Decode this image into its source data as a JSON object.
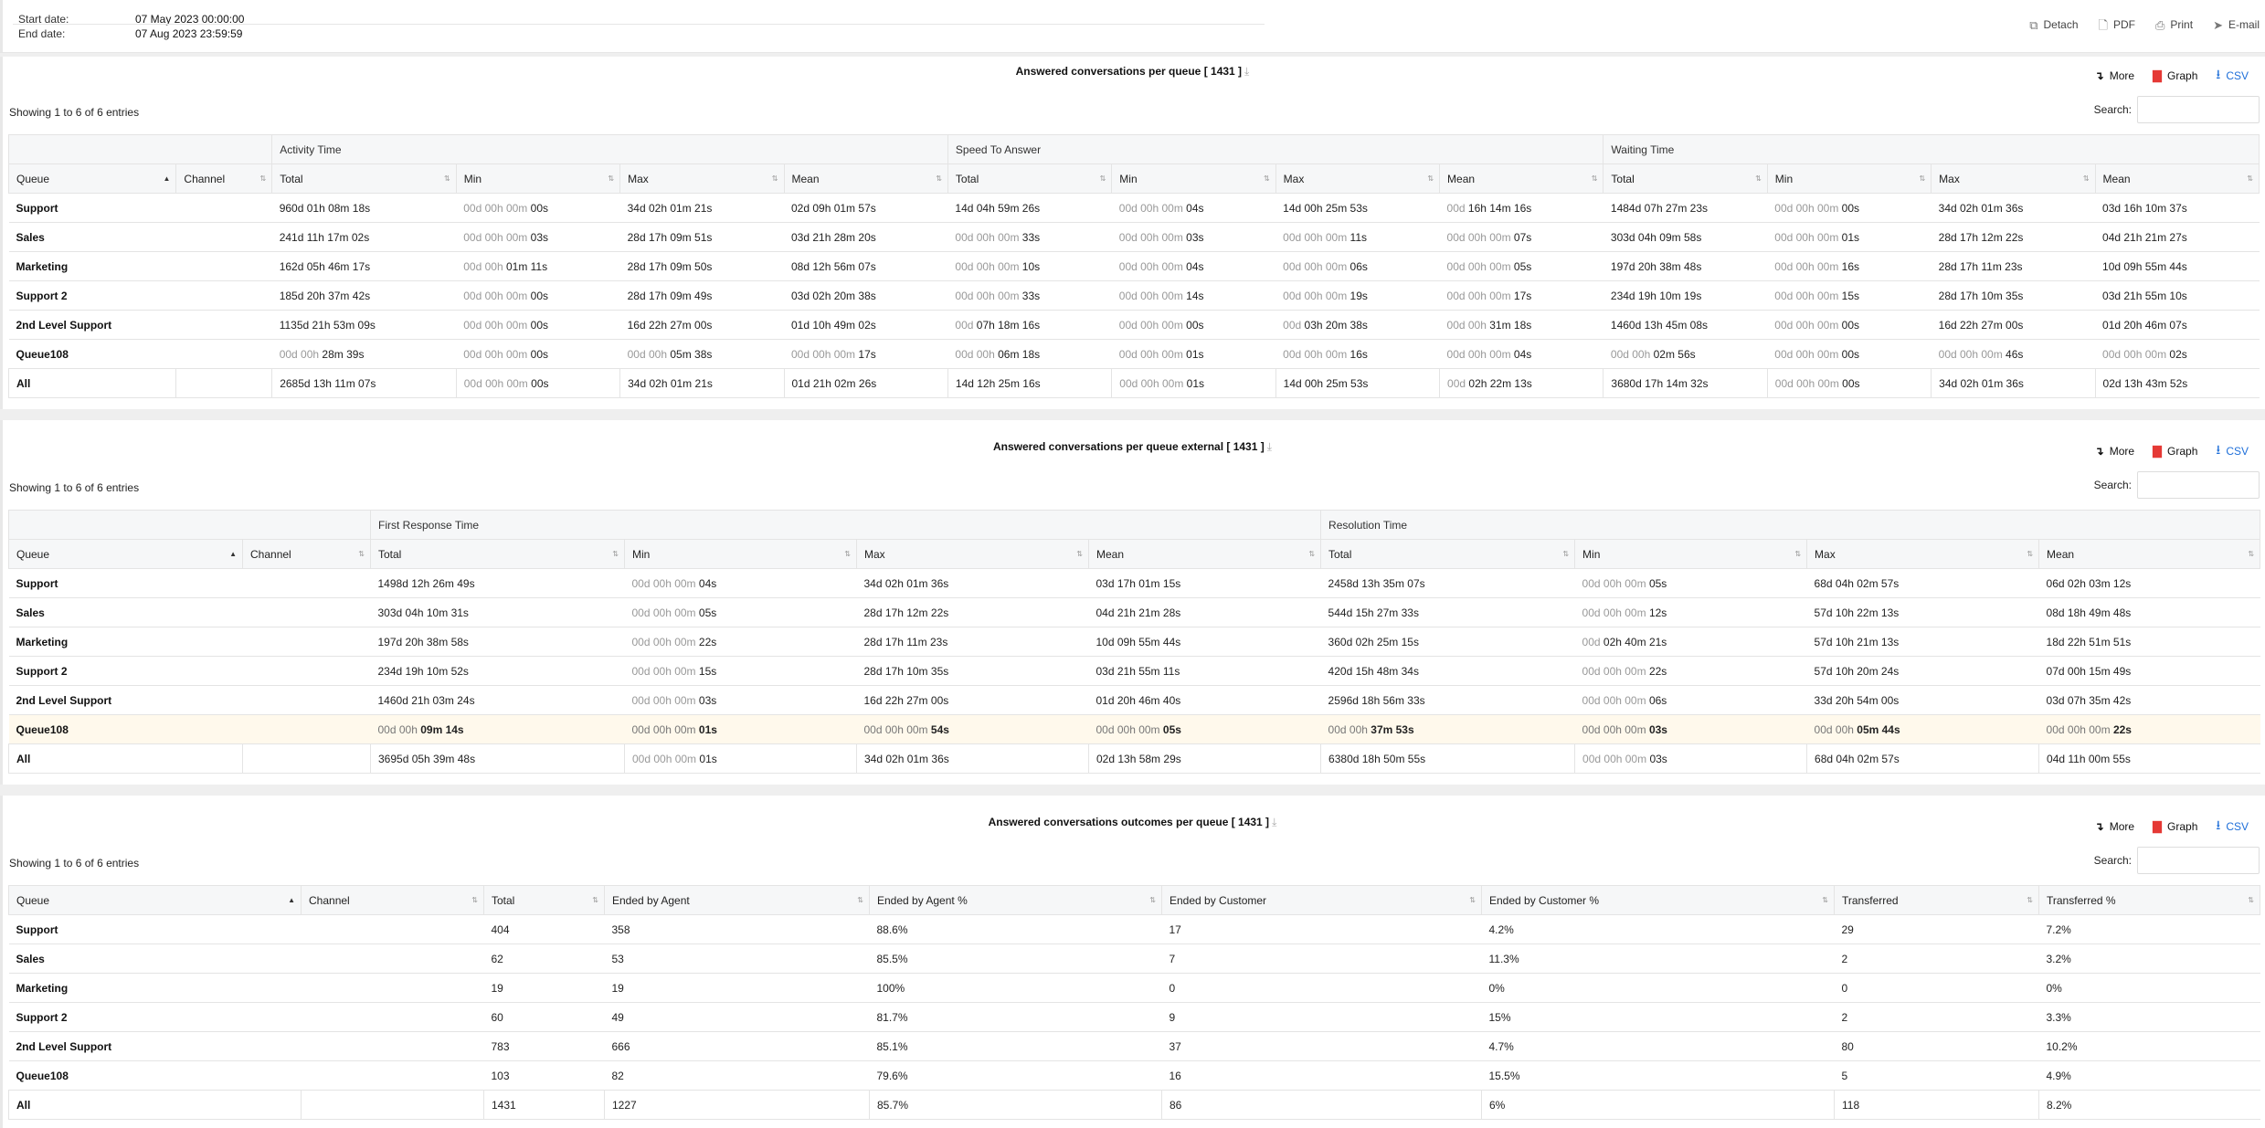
{
  "header": {
    "start_label": "Start date:",
    "start_value": "07 May 2023 00:00:00",
    "end_label": "End date:",
    "end_value": "07 Aug 2023 23:59:59",
    "actions": [
      "Detach",
      "PDF",
      "Print",
      "E-mail"
    ]
  },
  "common": {
    "more": "More",
    "graph": "Graph",
    "csv": "CSV",
    "search_label": "Search:",
    "showing": "Showing 1 to 6 of 6 entries"
  },
  "t1": {
    "title": "Answered conversations per queue [ 1431 ]",
    "groups": [
      "Activity Time",
      "Speed To Answer",
      "Waiting Time"
    ],
    "columns": [
      "Queue",
      "Channel",
      "Total",
      "Min",
      "Max",
      "Mean",
      "Total",
      "Min",
      "Max",
      "Mean",
      "Total",
      "Min",
      "Max",
      "Mean"
    ],
    "rows": [
      [
        "Support",
        "",
        "960d 01h 08m 18s",
        "00d 00h 00m 00s",
        "34d 02h 01m 21s",
        "02d 09h 01m 57s",
        "14d 04h 59m 26s",
        "00d 00h 00m 04s",
        "14d 00h 25m 53s",
        "00d 16h 14m 16s",
        "1484d 07h 27m 23s",
        "00d 00h 00m 00s",
        "34d 02h 01m 36s",
        "03d 16h 10m 37s"
      ],
      [
        "Sales",
        "",
        "241d 11h 17m 02s",
        "00d 00h 00m 03s",
        "28d 17h 09m 51s",
        "03d 21h 28m 20s",
        "00d 00h 00m 33s",
        "00d 00h 00m 03s",
        "00d 00h 00m 11s",
        "00d 00h 00m 07s",
        "303d 04h 09m 58s",
        "00d 00h 00m 01s",
        "28d 17h 12m 22s",
        "04d 21h 21m 27s"
      ],
      [
        "Marketing",
        "",
        "162d 05h 46m 17s",
        "00d 00h 01m 11s",
        "28d 17h 09m 50s",
        "08d 12h 56m 07s",
        "00d 00h 00m 10s",
        "00d 00h 00m 04s",
        "00d 00h 00m 06s",
        "00d 00h 00m 05s",
        "197d 20h 38m 48s",
        "00d 00h 00m 16s",
        "28d 17h 11m 23s",
        "10d 09h 55m 44s"
      ],
      [
        "Support 2",
        "",
        "185d 20h 37m 42s",
        "00d 00h 00m 00s",
        "28d 17h 09m 49s",
        "03d 02h 20m 38s",
        "00d 00h 00m 33s",
        "00d 00h 00m 14s",
        "00d 00h 00m 19s",
        "00d 00h 00m 17s",
        "234d 19h 10m 19s",
        "00d 00h 00m 15s",
        "28d 17h 10m 35s",
        "03d 21h 55m 10s"
      ],
      [
        "2nd Level Support",
        "",
        "1135d 21h 53m 09s",
        "00d 00h 00m 00s",
        "16d 22h 27m 00s",
        "01d 10h 49m 02s",
        "00d 07h 18m 16s",
        "00d 00h 00m 00s",
        "00d 03h 20m 38s",
        "00d 00h 31m 18s",
        "1460d 13h 45m 08s",
        "00d 00h 00m 00s",
        "16d 22h 27m 00s",
        "01d 20h 46m 07s"
      ],
      [
        "Queue108",
        "",
        "00d 00h 28m 39s",
        "00d 00h 00m 00s",
        "00d 00h 05m 38s",
        "00d 00h 00m 17s",
        "00d 00h 06m 18s",
        "00d 00h 00m 01s",
        "00d 00h 00m 16s",
        "00d 00h 00m 04s",
        "00d 00h 02m 56s",
        "00d 00h 00m 00s",
        "00d 00h 00m 46s",
        "00d 00h 00m 02s"
      ]
    ],
    "total": [
      "All",
      "",
      "2685d 13h 11m 07s",
      "00d 00h 00m 00s",
      "34d 02h 01m 21s",
      "01d 21h 02m 26s",
      "14d 12h 25m 16s",
      "00d 00h 00m 01s",
      "14d 00h 25m 53s",
      "00d 02h 22m 13s",
      "3680d 17h 14m 32s",
      "00d 00h 00m 00s",
      "34d 02h 01m 36s",
      "02d 13h 43m 52s"
    ]
  },
  "t2": {
    "title": "Answered conversations per queue external [ 1431 ]",
    "groups": [
      "First Response Time",
      "Resolution Time"
    ],
    "columns": [
      "Queue",
      "Channel",
      "Total",
      "Min",
      "Max",
      "Mean",
      "Total",
      "Min",
      "Max",
      "Mean"
    ],
    "rows": [
      [
        "Support",
        "",
        "1498d 12h 26m 49s",
        "00d 00h 00m 04s",
        "34d 02h 01m 36s",
        "03d 17h 01m 15s",
        "2458d 13h 35m 07s",
        "00d 00h 00m 05s",
        "68d 04h 02m 57s",
        "06d 02h 03m 12s"
      ],
      [
        "Sales",
        "",
        "303d 04h 10m 31s",
        "00d 00h 00m 05s",
        "28d 17h 12m 22s",
        "04d 21h 21m 28s",
        "544d 15h 27m 33s",
        "00d 00h 00m 12s",
        "57d 10h 22m 13s",
        "08d 18h 49m 48s"
      ],
      [
        "Marketing",
        "",
        "197d 20h 38m 58s",
        "00d 00h 00m 22s",
        "28d 17h 11m 23s",
        "10d 09h 55m 44s",
        "360d 02h 25m 15s",
        "00d 02h 40m 21s",
        "57d 10h 21m 13s",
        "18d 22h 51m 51s"
      ],
      [
        "Support 2",
        "",
        "234d 19h 10m 52s",
        "00d 00h 00m 15s",
        "28d 17h 10m 35s",
        "03d 21h 55m 11s",
        "420d 15h 48m 34s",
        "00d 00h 00m 22s",
        "57d 10h 20m 24s",
        "07d 00h 15m 49s"
      ],
      [
        "2nd Level Support",
        "",
        "1460d 21h 03m 24s",
        "00d 00h 00m 03s",
        "16d 22h 27m 00s",
        "01d 20h 46m 40s",
        "2596d 18h 56m 33s",
        "00d 00h 00m 06s",
        "33d 20h 54m 00s",
        "03d 07h 35m 42s"
      ],
      [
        "Queue108",
        "",
        "00d 00h 09m 14s",
        "00d 00h 00m 01s",
        "00d 00h 00m 54s",
        "00d 00h 00m 05s",
        "00d 00h 37m 53s",
        "00d 00h 00m 03s",
        "00d 00h 05m 44s",
        "00d 00h 00m 22s"
      ]
    ],
    "total": [
      "All",
      "",
      "3695d 05h 39m 48s",
      "00d 00h 00m 01s",
      "34d 02h 01m 36s",
      "02d 13h 58m 29s",
      "6380d 18h 50m 55s",
      "00d 00h 00m 03s",
      "68d 04h 02m 57s",
      "04d 11h 00m 55s"
    ]
  },
  "t3": {
    "title": "Answered conversations outcomes per queue [ 1431 ]",
    "columns": [
      "Queue",
      "Channel",
      "Total",
      "Ended by Agent",
      "Ended by Agent %",
      "Ended by Customer",
      "Ended by Customer %",
      "Transferred",
      "Transferred %"
    ],
    "rows": [
      [
        "Support",
        "",
        "404",
        "358",
        "88.6%",
        "17",
        "4.2%",
        "29",
        "7.2%"
      ],
      [
        "Sales",
        "",
        "62",
        "53",
        "85.5%",
        "7",
        "11.3%",
        "2",
        "3.2%"
      ],
      [
        "Marketing",
        "",
        "19",
        "19",
        "100%",
        "0",
        "0%",
        "0",
        "0%"
      ],
      [
        "Support 2",
        "",
        "60",
        "49",
        "81.7%",
        "9",
        "15%",
        "2",
        "3.3%"
      ],
      [
        "2nd Level Support",
        "",
        "783",
        "666",
        "85.1%",
        "37",
        "4.7%",
        "80",
        "10.2%"
      ],
      [
        "Queue108",
        "",
        "103",
        "82",
        "79.6%",
        "16",
        "15.5%",
        "5",
        "4.9%"
      ]
    ],
    "total": [
      "All",
      "",
      "1431",
      "1227",
      "85.7%",
      "86",
      "6%",
      "118",
      "8.2%"
    ]
  }
}
